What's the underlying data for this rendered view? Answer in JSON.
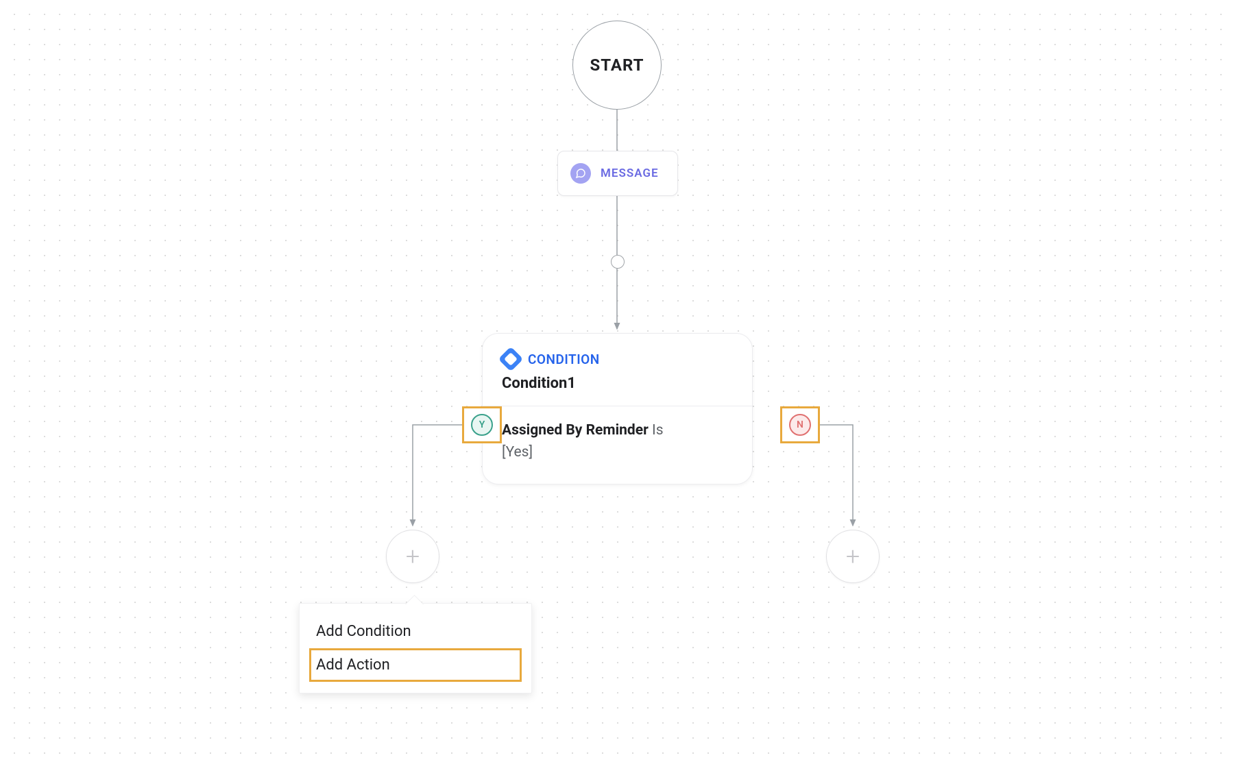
{
  "start": {
    "label": "START"
  },
  "message": {
    "label": "MESSAGE"
  },
  "condition": {
    "type_label": "CONDITION",
    "name": "Condition1",
    "field": "Assigned By Reminder",
    "operator": "Is",
    "value": "[Yes]",
    "yes_badge": "Y",
    "no_badge": "N"
  },
  "popover": {
    "items": [
      {
        "label": "Add Condition",
        "highlighted": false
      },
      {
        "label": "Add Action",
        "highlighted": true
      }
    ]
  }
}
